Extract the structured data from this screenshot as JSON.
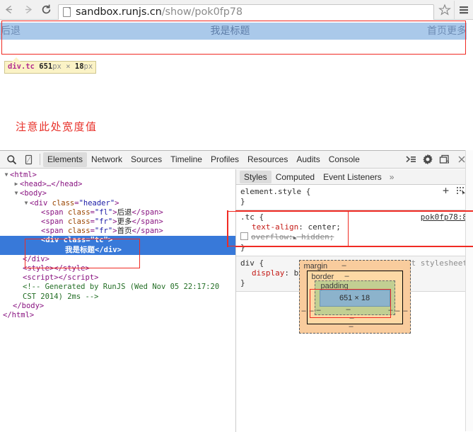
{
  "browser": {
    "back_icon": "arrow-left-icon",
    "forward_icon": "arrow-right-icon",
    "reload_icon": "reload-icon",
    "url_full": "sandbox.runjs.cn/show/pok0fp78",
    "url_host": "sandbox.runjs.cn",
    "url_path": "/show/pok0fp78",
    "star_icon": "star-icon",
    "menu_icon": "hamburger-menu-icon"
  },
  "page": {
    "header_left": "后退",
    "header_center": "我是标题",
    "header_right": "首页更多",
    "tooltip_selector": "div.tc",
    "tooltip_width": "651",
    "tooltip_x": "×",
    "tooltip_height": "18",
    "tooltip_unit": "px",
    "annotation_note": "注意此处宽度值"
  },
  "devtools": {
    "inspect_icon": "magnifier-inspect-icon",
    "device_icon": "device-toggle-icon",
    "tabs": [
      {
        "label": "Elements",
        "active": true
      },
      {
        "label": "Network",
        "active": false
      },
      {
        "label": "Sources",
        "active": false
      },
      {
        "label": "Timeline",
        "active": false
      },
      {
        "label": "Profiles",
        "active": false
      },
      {
        "label": "Resources",
        "active": false
      },
      {
        "label": "Audits",
        "active": false
      },
      {
        "label": "Console",
        "active": false
      }
    ],
    "right_icons": [
      "console-drawer-icon",
      "gear-settings-icon",
      "dock-position-icon",
      "close-icon"
    ],
    "dom": {
      "line_html_open": "<html>",
      "line_head": "<head>…</head>",
      "line_body_open": "<body>",
      "div_header_tag": "div",
      "div_header_attr": "class",
      "div_header_val": "\"header\"",
      "span1_tag": "span",
      "span1_attr": "class",
      "span1_val": "\"fl\"",
      "span1_text": "后退",
      "span2_tag": "span",
      "span2_attr": "class",
      "span2_val": "\"fr\"",
      "span2_text": "更多",
      "span3_tag": "span",
      "span3_attr": "class",
      "span3_val": "\"fr\"",
      "span3_text": "首页",
      "sel_tag": "div",
      "sel_attr": "class",
      "sel_val": "\"tc\"",
      "sel_text": "我是标题",
      "sel_close": "</div>",
      "div_close": "</div>",
      "style_line": "<style></style>",
      "script_line": "<script></script>",
      "comment_line1": "<!-- Generated by RunJS (Wed Nov 05 22:17:20",
      "comment_line2": "CST 2014) 2ms -->",
      "body_close": "</body>",
      "html_close": "</html>"
    },
    "styles": {
      "tabs": [
        {
          "label": "Styles",
          "active": true
        },
        {
          "label": "Computed",
          "active": false
        },
        {
          "label": "Event Listeners",
          "active": false
        }
      ],
      "more": "»",
      "rule_element_style": "element.style {",
      "brace_close": "}",
      "add_icon": "plus-icon",
      "pick_icon": "element-state-icon",
      "rule_tc_selector": ".tc {",
      "rule_tc_link": "pok0fp78:8",
      "prop_text_align_name": "text-align",
      "prop_text_align_value": ": center;",
      "prop_overflow_name": "overflow",
      "prop_overflow_value": ": hidden;",
      "rule_div_selector": "div {",
      "rule_div_origin": "user agent stylesheet",
      "prop_display_name": "display",
      "prop_display_value": ": block;"
    },
    "boxmodel": {
      "margin_label": "margin",
      "border_label": "border",
      "padding_label": "padding",
      "content_size": "651 × 18",
      "dash": "–"
    }
  },
  "colors": {
    "annotation_red": "#f02b23",
    "selection_blue": "#3879d9",
    "page_header_blue": "#aac9ea",
    "tooltip_yellow": "#fbf3c6"
  }
}
